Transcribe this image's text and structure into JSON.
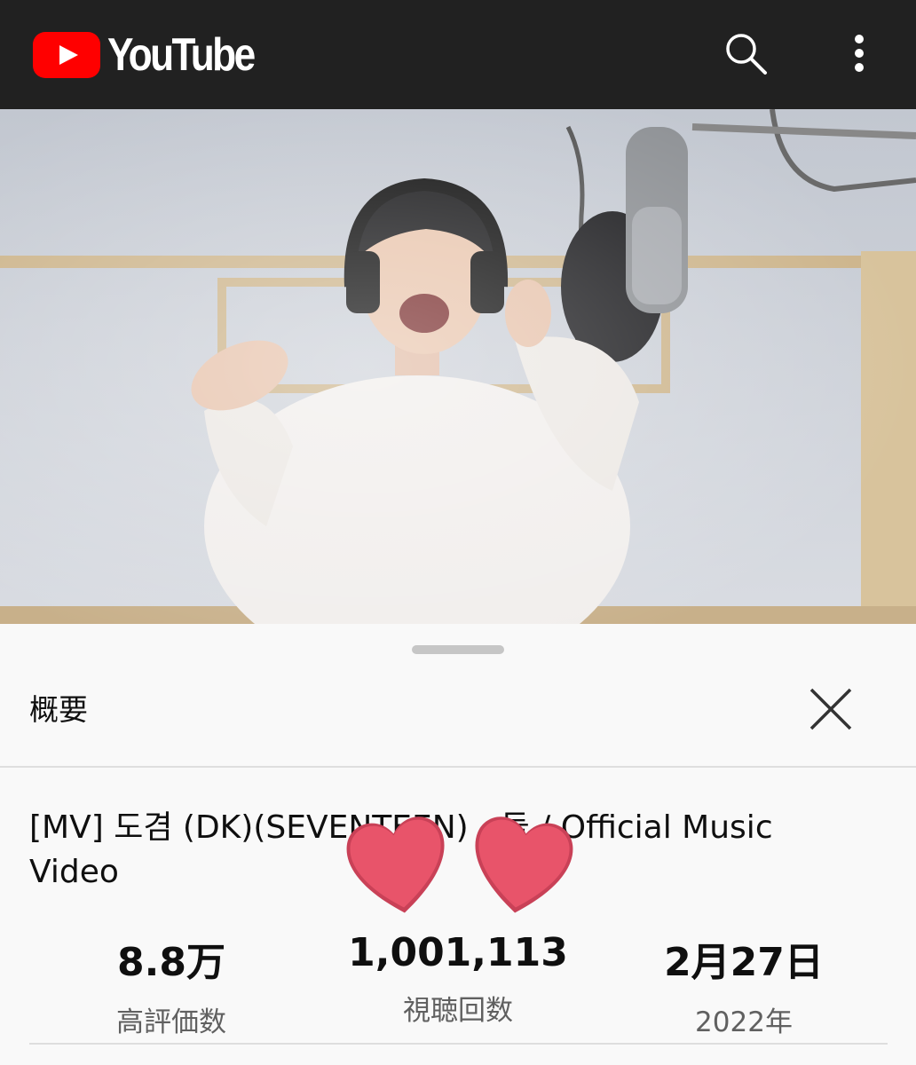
{
  "app": {
    "brand": "YouTube"
  },
  "icons": {
    "search": "search-icon",
    "more": "more-vert-icon",
    "close": "close-icon",
    "logo": "youtube-logo-icon"
  },
  "colors": {
    "header_bg": "#212121",
    "brand_red": "#ff0000",
    "heart": "#e8546a"
  },
  "sheet": {
    "title": "概要",
    "video_title": "[MV] 도겸 (DK)(SEVENTEEN) - 둘 / Official Music Video",
    "stats": [
      {
        "value": "8.8万",
        "label": "高評価数"
      },
      {
        "value": "1,001,113",
        "label": "視聴回数"
      },
      {
        "value": "2月27日",
        "label": "2022年"
      }
    ]
  }
}
